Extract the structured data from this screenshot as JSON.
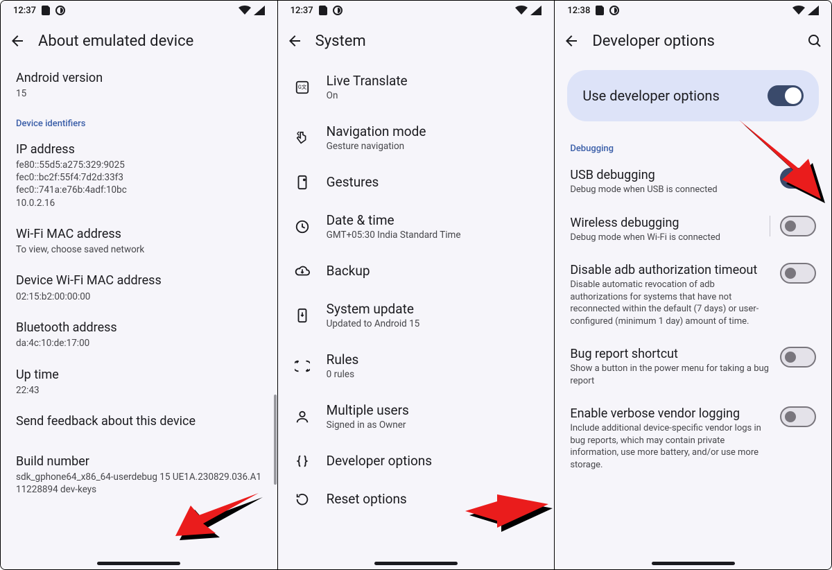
{
  "panel1": {
    "time": "12:37",
    "title": "About emulated device",
    "androidVersion": {
      "label": "Android version",
      "value": "15"
    },
    "sectionDeviceIdentifiers": "Device identifiers",
    "ip": {
      "label": "IP address",
      "value": "fe80::55d5:a275:329:9025\nfec0::bc2f:55f4:7d2d:33f3\nfec0::741a:e76b:4adf:10bc\n10.0.2.16"
    },
    "wifiMac": {
      "label": "Wi-Fi MAC address",
      "value": "To view, choose saved network"
    },
    "deviceWifiMac": {
      "label": "Device Wi-Fi MAC address",
      "value": "02:15:b2:00:00:00"
    },
    "bt": {
      "label": "Bluetooth address",
      "value": "da:4c:10:de:17:00"
    },
    "uptime": {
      "label": "Up time",
      "value": "22:43"
    },
    "feedback": "Send feedback about this device",
    "build": {
      "label": "Build number",
      "value": "sdk_gphone64_x86_64-userdebug 15 UE1A.230829.036.A1 11228894 dev-keys"
    }
  },
  "panel2": {
    "time": "12:37",
    "title": "System",
    "items": [
      {
        "icon": "translate",
        "title": "Live Translate",
        "sub": "On"
      },
      {
        "icon": "swipe",
        "title": "Navigation mode",
        "sub": "Gesture navigation"
      },
      {
        "icon": "gesture",
        "title": "Gestures",
        "sub": ""
      },
      {
        "icon": "clock",
        "title": "Date & time",
        "sub": "GMT+05:30 India Standard Time"
      },
      {
        "icon": "cloud",
        "title": "Backup",
        "sub": ""
      },
      {
        "icon": "update",
        "title": "System update",
        "sub": "Updated to Android 15"
      },
      {
        "icon": "rules",
        "title": "Rules",
        "sub": "0 rules"
      },
      {
        "icon": "users",
        "title": "Multiple users",
        "sub": "Signed in as Owner"
      },
      {
        "icon": "braces",
        "title": "Developer options",
        "sub": ""
      },
      {
        "icon": "reset",
        "title": "Reset options",
        "sub": ""
      }
    ]
  },
  "panel3": {
    "time": "12:38",
    "title": "Developer options",
    "banner": "Use developer options",
    "sectionDebugging": "Debugging",
    "items": [
      {
        "title": "USB debugging",
        "sub": "Debug mode when USB is connected",
        "on": true,
        "divider": false
      },
      {
        "title": "Wireless debugging",
        "sub": "Debug mode when Wi-Fi is connected",
        "on": false,
        "divider": true
      },
      {
        "title": "Disable adb authorization timeout",
        "sub": "Disable automatic revocation of adb authorizations for systems that have not reconnected within the default (7 days) or user-configured (minimum 1 day) amount of time.",
        "on": false,
        "divider": false
      },
      {
        "title": "Bug report shortcut",
        "sub": "Show a button in the power menu for taking a bug report",
        "on": false,
        "divider": false
      },
      {
        "title": "Enable verbose vendor logging",
        "sub": "Include additional device-specific vendor logs in bug reports, which may contain private information, use more battery, and/or use more storage.",
        "on": false,
        "divider": false
      }
    ]
  }
}
